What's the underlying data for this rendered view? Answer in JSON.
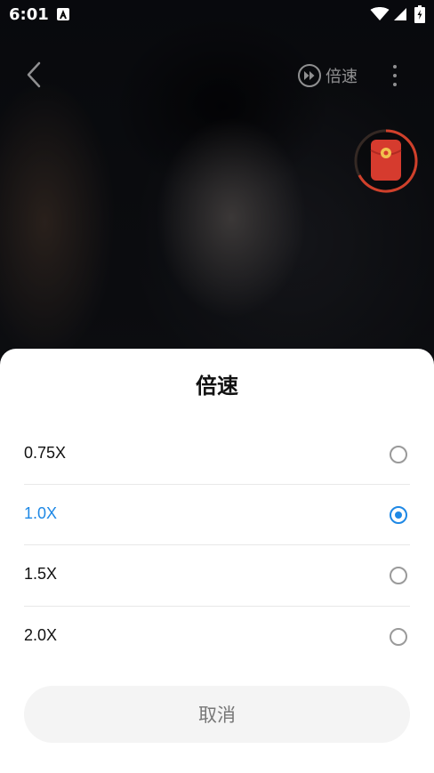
{
  "status_bar": {
    "time": "6:01"
  },
  "player": {
    "speed_button_label": "倍速"
  },
  "speed_sheet": {
    "title": "倍速",
    "options": [
      {
        "label": "0.75X",
        "selected": false
      },
      {
        "label": "1.0X",
        "selected": true
      },
      {
        "label": "1.5X",
        "selected": false
      },
      {
        "label": "2.0X",
        "selected": false
      }
    ],
    "cancel_label": "取消"
  },
  "colors": {
    "accent": "#1e88e5",
    "sheet_background": "#ffffff",
    "cancel_button_background": "#f4f4f4",
    "cancel_text": "#777777"
  },
  "icons": {
    "back": "chevron-left-icon",
    "speed": "fast-forward-circle-icon",
    "more": "more-vertical-icon",
    "red_packet": "red-envelope-icon"
  }
}
